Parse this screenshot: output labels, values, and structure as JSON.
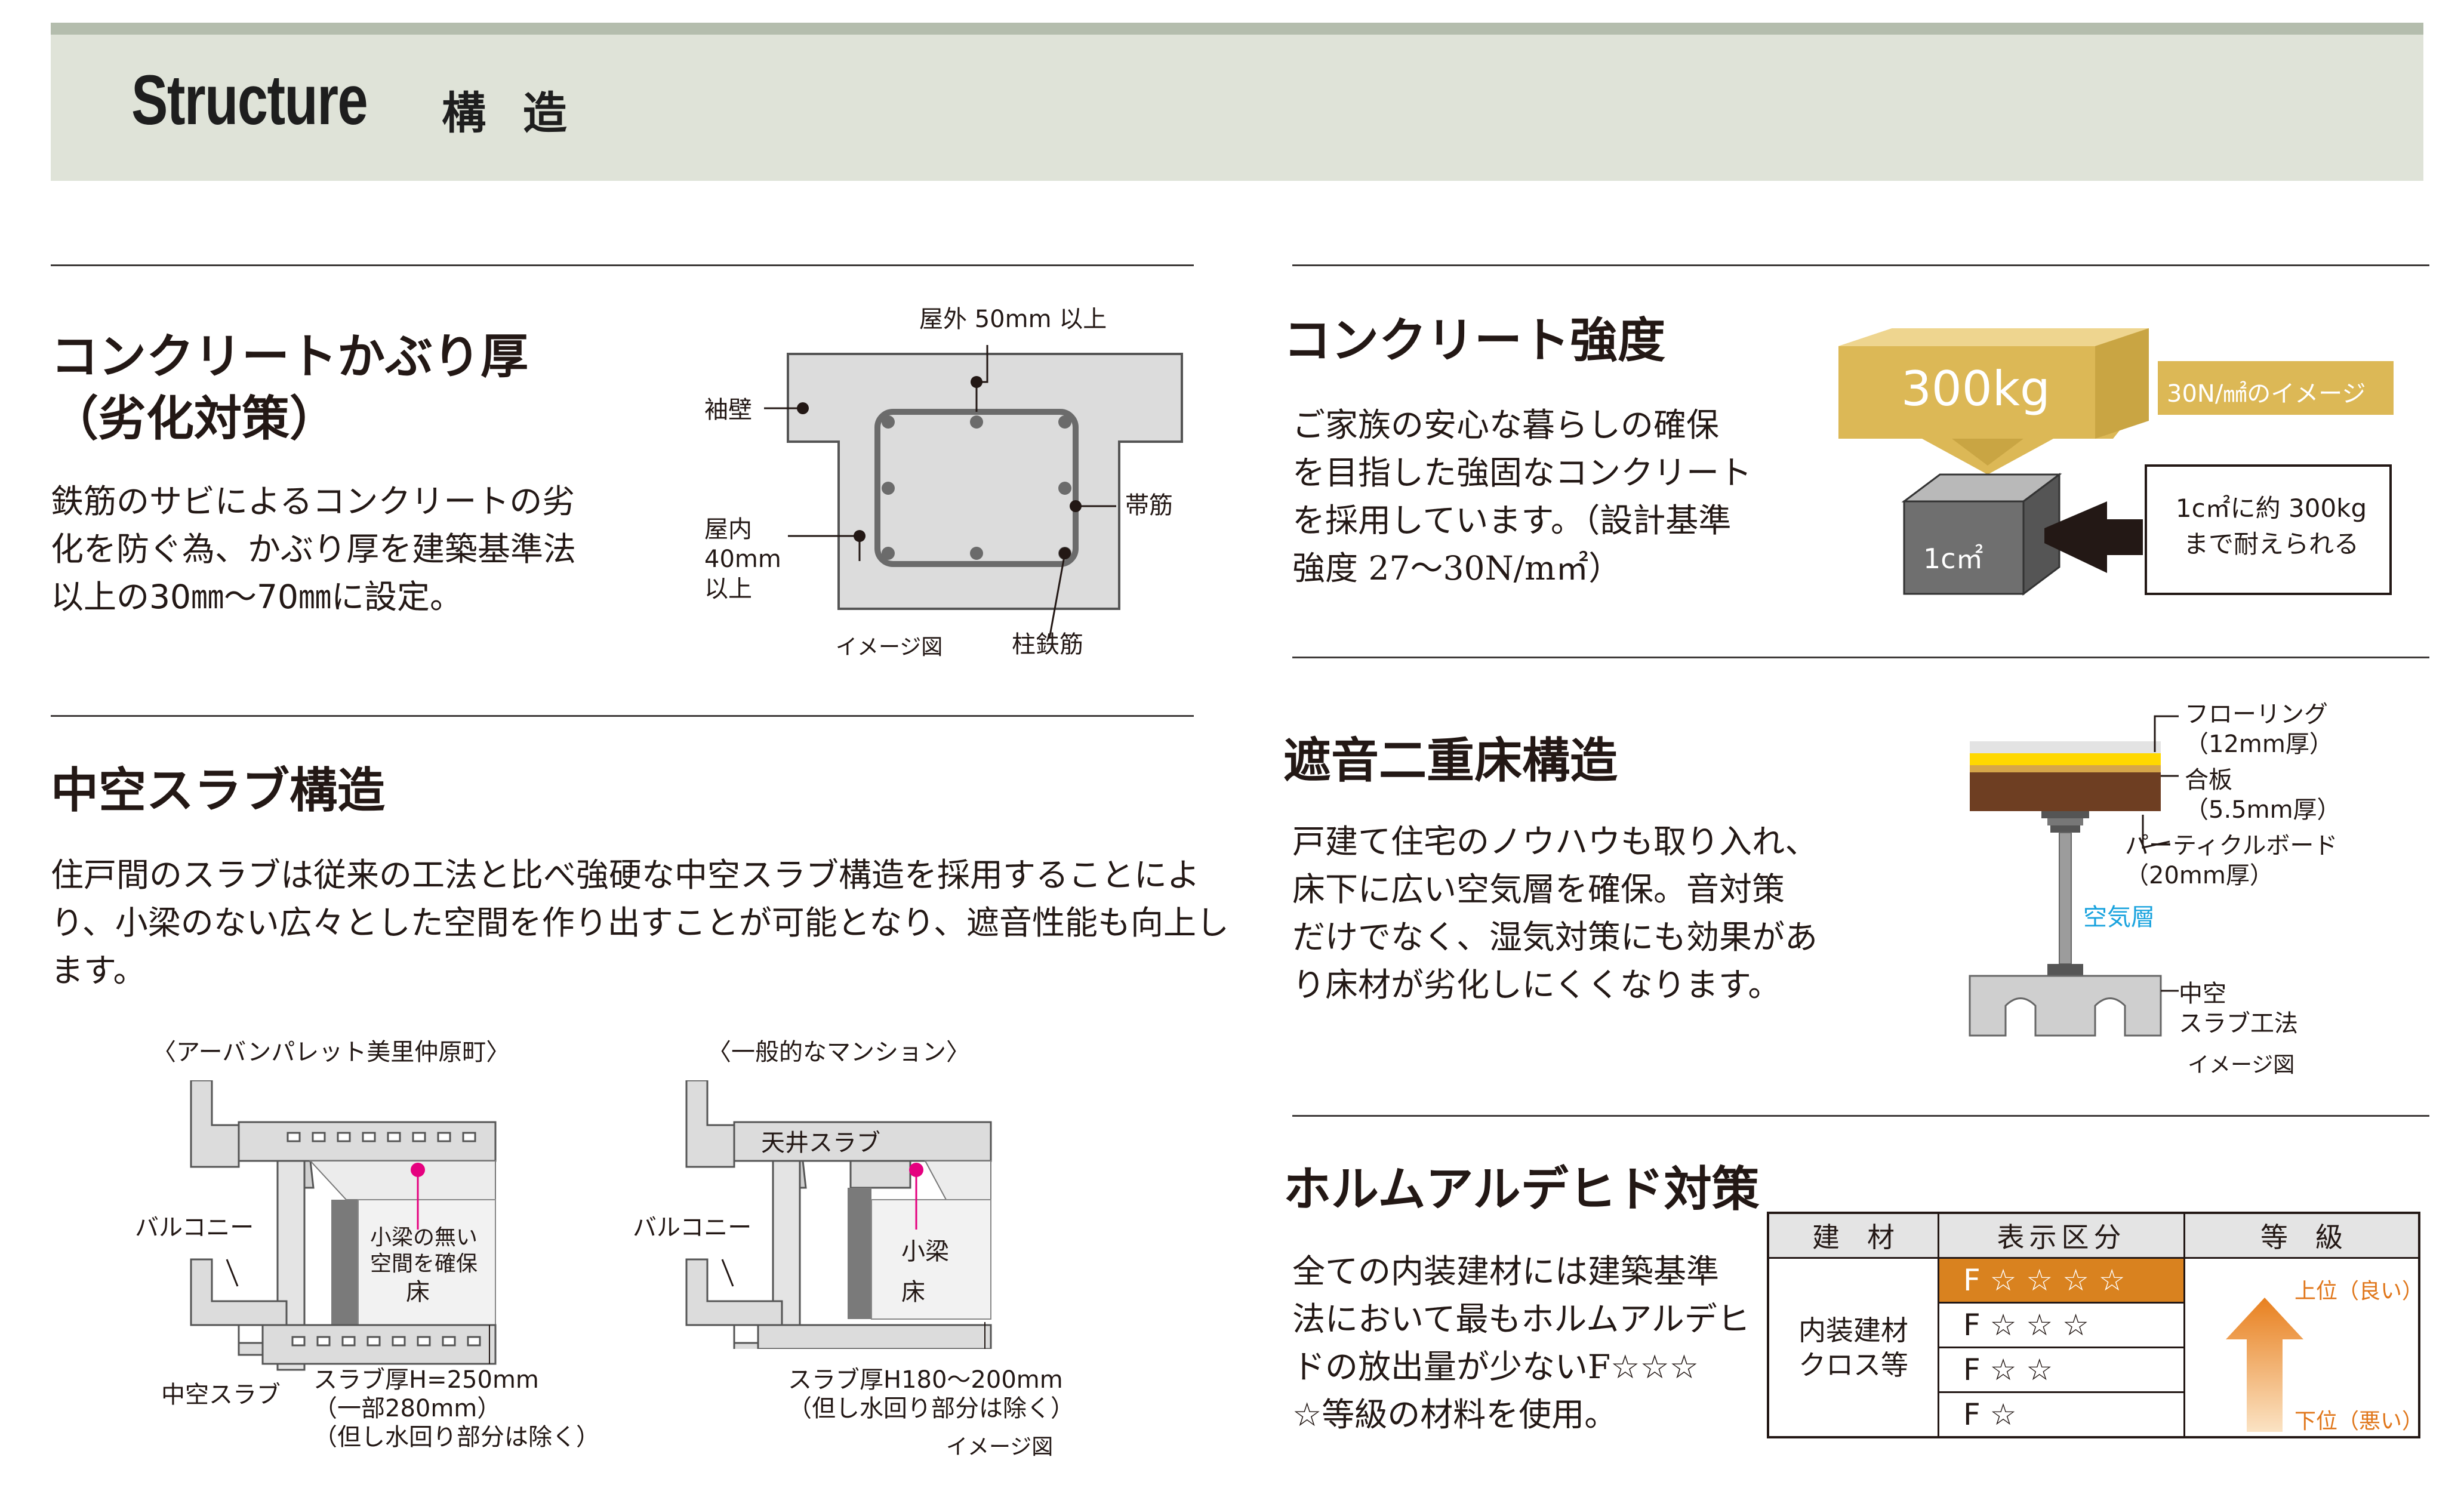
{
  "header": {
    "title_en": "Structure",
    "title_ja": "構 造"
  },
  "cover": {
    "title": "コンクリートかぶり厚\n（劣化対策）",
    "body": "鉄筋のサビによるコンクリートの劣\n化を防ぐ為、かぶり厚を建築基準法\n以上の30㎜～70㎜に設定。",
    "labels": {
      "outdoor": "屋外 50mm 以上",
      "sode": "袖壁",
      "obi": "帯筋",
      "indoor": "屋内\n40mm\n以上",
      "hashira": "柱鉄筋",
      "image": "イメージ図"
    }
  },
  "slab": {
    "title": "中空スラブ構造",
    "body": "住戸間のスラブは従来の工法と比べ強硬な中空スラブ構造を採用することによ\nり、小梁のない広々とした空間を作り出すことが可能となり、遮音性能も向上し\nます。",
    "left": {
      "caption": "〈アーバンパレット美里仲原町〉",
      "balcony": "バルコニー",
      "nobeam": "小梁の無い\n空間を確保",
      "floor": "床",
      "hollow": "中空スラブ",
      "thickness": "スラブ厚H=250mm\n（一部280mm）\n（但し水回り部分は除く）"
    },
    "right": {
      "caption": "〈一般的なマンション〉",
      "ceiling": "天井スラブ",
      "balcony": "バルコニー",
      "beam": "小梁",
      "floor": "床",
      "thickness": "スラブ厚H180～200mm\n（但し水回り部分は除く）",
      "image": "イメージ図"
    }
  },
  "strength": {
    "title": "コンクリート強度",
    "body": "ご家族の安心な暮らしの確保\nを目指した強固なコンクリート\nを採用しています。（設計基準\n強度 27～30N/m㎡）",
    "weight": "300kg",
    "image_label": "30N/㎟のイメージ",
    "cube": "1c㎡",
    "endure": "1c㎡に約 300kg\nまで耐えられる",
    "colors": {
      "gold": "#dcb856",
      "cube": "#6f6f6f"
    }
  },
  "sound": {
    "title": "遮音二重床構造",
    "body": "戸建て住宅のノウハウも取り入れ、\n床下に広い空気層を確保。音対策\nだけでなく、湿気対策にも効果があ\nり床材が劣化しにくくなります。",
    "labels": {
      "flooring": "フローリング\n（12mm厚）",
      "plywood": "合板\n（5.5mm厚）",
      "particle": "パーティクルボード\n（20mm厚）",
      "air": "空気層",
      "hollow": "中空\nスラブ工法",
      "image": "イメージ図"
    }
  },
  "formaldehyde": {
    "title": "ホルムアルデヒド対策",
    "body": "全ての内装建材には建築基準\n法において最もホルムアルデヒ\nドの放出量が少ないF☆☆☆\n☆等級の材料を使用。",
    "table": {
      "headers": [
        "建　材",
        "表示区分",
        "等　級"
      ],
      "material": "内装建材\nクロス等",
      "rows": [
        "F ☆ ☆ ☆ ☆",
        "F ☆ ☆ ☆",
        "F ☆ ☆",
        "F ☆"
      ],
      "upper": "上位（良い）",
      "lower": "下位（悪い）",
      "colors": {
        "highlight": "#d9821f",
        "header": "#e4e4e4",
        "arrow": "#ee9a3a",
        "accent": "#e0761a"
      }
    }
  }
}
